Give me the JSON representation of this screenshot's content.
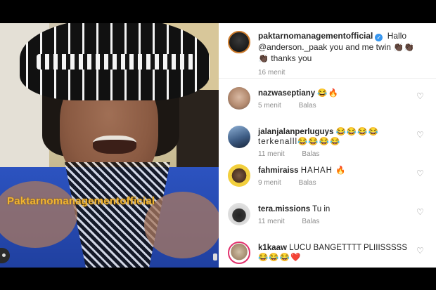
{
  "media": {
    "watermark": "Paktarnomanagementofficial"
  },
  "caption": {
    "username": "paktarnomanagementofficial",
    "text_pre": "Hallo ",
    "mention": "@anderson._paak",
    "text_post": " you and me twin 👏🏿👏🏿",
    "text_line2": "👏🏿 thanks you",
    "time": "16 menit"
  },
  "comments": [
    {
      "username": "nazwaseptiany",
      "text": "😂🔥",
      "time": "5 menit",
      "reply": "Balas"
    },
    {
      "username": "jalanjalanperluguys",
      "text": "😂😂😂😂",
      "text_line2": "terkenalll😂😂😂😂",
      "time": "11 menit",
      "reply": "Balas"
    },
    {
      "username": "fahmiraiss",
      "text": "HAHAH 🔥",
      "time": "9 menit",
      "reply": "Balas"
    },
    {
      "username": "tera.missions",
      "text": "Tu in",
      "time": "11 menit",
      "reply": "Balas"
    },
    {
      "username": "k1kaaw",
      "text": "LUCU BANGETTTT PLIIISSSSS",
      "text_line2": "😂😂😂❤️",
      "time": "",
      "reply": ""
    }
  ],
  "icons": {
    "verified": "verified-badge-icon",
    "heart": "heart-icon"
  },
  "colors": {
    "verified": "#3897f0",
    "meta_text": "#8e8e8e",
    "watermark": "#f2b531"
  }
}
